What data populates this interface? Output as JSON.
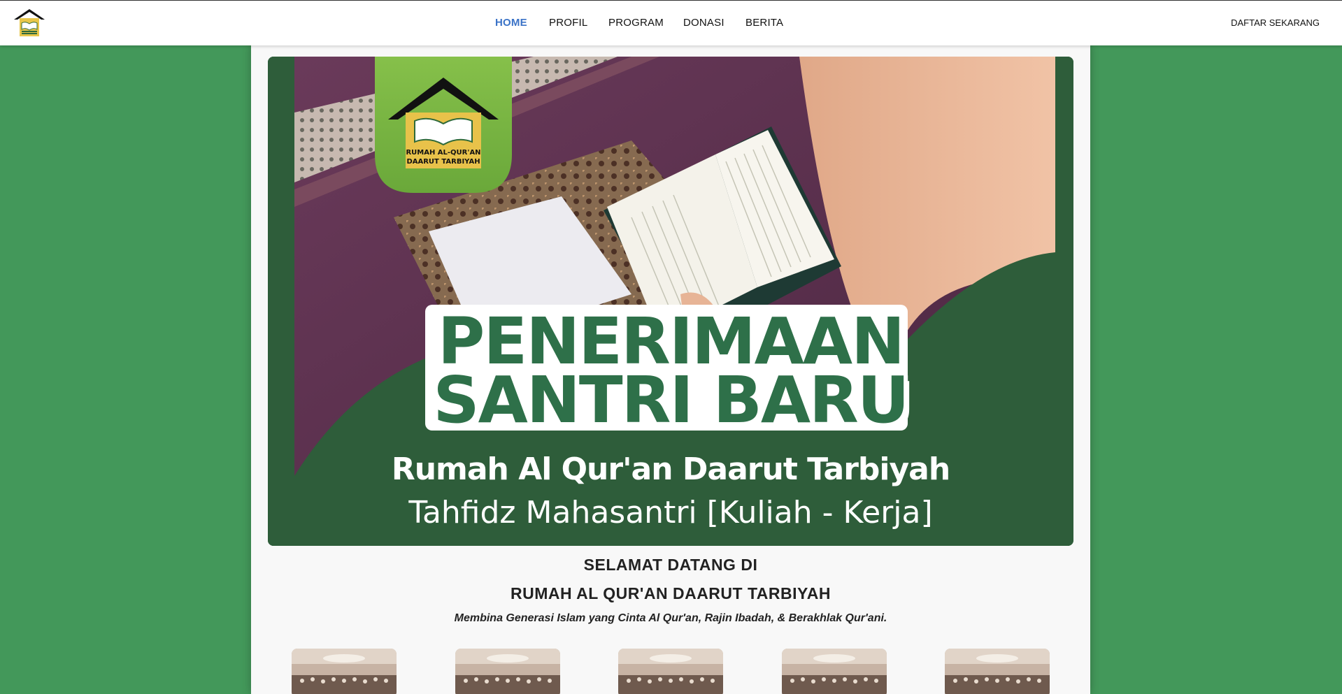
{
  "nav": {
    "brand_logo": "rumah-quran-logo",
    "items": [
      {
        "label": "HOME",
        "active": true
      },
      {
        "label": "PROFIL",
        "active": false
      },
      {
        "label": "PROGRAM",
        "active": false
      },
      {
        "label": "DONASI",
        "active": false
      },
      {
        "label": "BERITA",
        "active": false
      }
    ],
    "cta_label": "DAFTAR SEKARANG",
    "active_color": "#3b73c7"
  },
  "hero": {
    "logo_text_line1": "RUMAH AL-QUR'AN",
    "logo_text_line2": "DAARUT TARBIYAH",
    "headline_line1": "PENERIMAAN",
    "headline_line2": "SANTRI BARU",
    "subtitle": "Rumah Al Qur'an Daarut Tarbiyah",
    "subtitle2": "Tahfidz Mahasantri [Kuliah - Kerja]",
    "brand_green": "#2e7049"
  },
  "welcome": {
    "line1": "SELAMAT DATANG DI",
    "line2": "RUMAH AL QUR'AN DAARUT TARBIYAH",
    "tagline": "Membina Generasi Islam yang Cinta Al Qur'an, Rajin Ibadah, & Berakhlak Qur'ani."
  },
  "gallery": {
    "count": 5,
    "item_name": "group-photo"
  },
  "colors": {
    "page_background": "#43985a",
    "content_background": "#f8f8f8"
  }
}
